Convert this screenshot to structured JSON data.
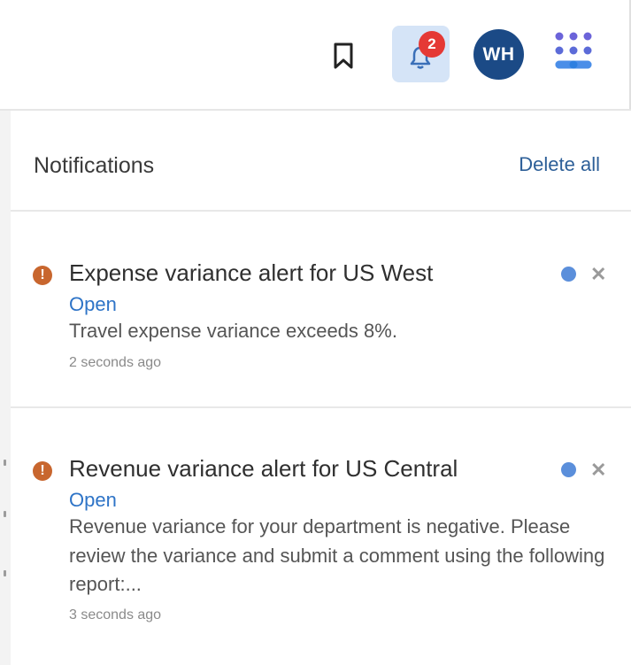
{
  "topbar": {
    "notification_count": "2",
    "avatar_initials": "WH",
    "icons": [
      "bookmark-icon",
      "bell-icon",
      "apps-grid-icon"
    ]
  },
  "panel": {
    "title": "Notifications",
    "delete_all_label": "Delete all",
    "notifications": [
      {
        "title": "Expense variance alert for US West",
        "link_label": "Open",
        "body": "Travel expense variance exceeds 8%.",
        "time": "2 seconds ago",
        "status_icon": "alert-icon",
        "unread": true
      },
      {
        "title": "Revenue variance alert for US Central",
        "link_label": "Open",
        "body": "Revenue variance for your department is negative. Please review the variance and submit a comment using the following report:...",
        "time": "3 seconds ago",
        "status_icon": "alert-icon",
        "unread": true
      }
    ]
  },
  "colors": {
    "accent_blue": "#2e74c7",
    "badge_red": "#e53935",
    "avatar_bg": "#1b4a86",
    "alert_orange": "#c8662e",
    "unread_dot": "#5b8fdb"
  }
}
